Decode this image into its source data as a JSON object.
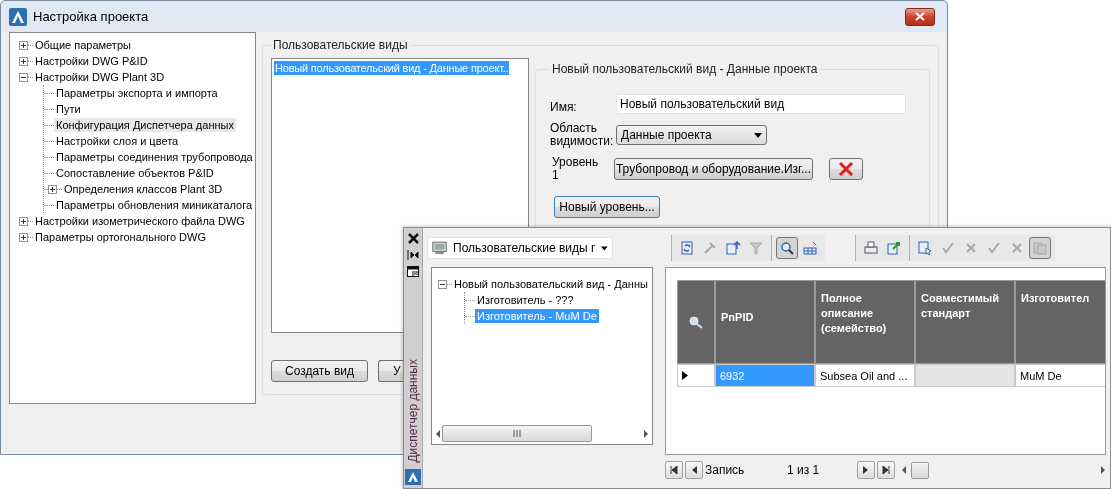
{
  "dialog": {
    "title": "Настройка проекта",
    "tree": [
      {
        "label": "Общие параметры",
        "expanded": false,
        "selected": false
      },
      {
        "label": "Настройки DWG P&ID",
        "expanded": false,
        "selected": false
      },
      {
        "label": "Настройки DWG Plant 3D",
        "expanded": true,
        "selected": false,
        "children": [
          {
            "label": "Параметры экспорта и импорта",
            "selected": false
          },
          {
            "label": "Пути",
            "selected": false
          },
          {
            "label": "Конфигурация Диспетчера данных",
            "selected": true
          },
          {
            "label": "Настройки слоя и цвета",
            "selected": false
          },
          {
            "label": "Параметры соединения трубопровода",
            "selected": false
          },
          {
            "label": "Сопоставление объектов P&ID",
            "selected": false
          },
          {
            "label": "Определения классов Plant 3D",
            "expanded": false,
            "selected": false
          },
          {
            "label": "Параметры обновления миникаталога",
            "selected": false
          }
        ]
      },
      {
        "label": "Настройки изометрического файла DWG",
        "expanded": false,
        "selected": false
      },
      {
        "label": "Параметры ортогонального DWG",
        "expanded": false,
        "selected": false
      }
    ],
    "views_group": {
      "title": "Пользовательские виды",
      "views": [
        {
          "label": "Новый пользовательский вид - Данные проект..",
          "selected": true
        }
      ],
      "buttons": [
        "Создать вид",
        "У"
      ]
    },
    "view_group": {
      "title": "Новый пользовательский вид - Данные проекта",
      "name_label": "Имя:",
      "name_value": "Новый пользовательский вид",
      "scope_label": "Область видимости:",
      "scope_value": "Данные проекта",
      "levels": [
        {
          "label": "Уровень 1",
          "value": "Трубопровод  и оборудование.Изг..."
        }
      ],
      "new_level_button": "Новый уровень..."
    }
  },
  "palette": {
    "side_title": "Диспетчер данных",
    "view_select": "Пользовательские виды г",
    "toolbar": [
      {
        "buttons": [
          {
            "kind": "sync",
            "disabled": false,
            "selected": false
          },
          {
            "kind": "edit",
            "disabled": true,
            "selected": false
          },
          {
            "kind": "upload",
            "disabled": false,
            "selected": false
          },
          {
            "kind": "filter",
            "disabled": true,
            "selected": false
          }
        ]
      },
      {
        "buttons": [
          {
            "kind": "zoom",
            "disabled": false,
            "selected": true
          },
          {
            "kind": "grid",
            "disabled": false,
            "selected": false
          }
        ]
      },
      {
        "buttons": [
          {
            "kind": "print",
            "disabled": false,
            "selected": false
          },
          {
            "kind": "export",
            "disabled": false,
            "selected": false
          }
        ]
      },
      {
        "buttons": [
          {
            "kind": "pick",
            "disabled": false,
            "selected": false
          },
          {
            "kind": "accept",
            "disabled": true,
            "selected": false
          },
          {
            "kind": "reject",
            "disabled": true,
            "selected": false
          },
          {
            "kind": "accept",
            "disabled": true,
            "selected": false
          },
          {
            "kind": "reject",
            "disabled": true,
            "selected": false
          },
          {
            "kind": "compare",
            "disabled": true,
            "selected": true
          }
        ]
      }
    ],
    "tree": [
      {
        "label": "Новый пользовательский вид - Данны",
        "expanded": true,
        "selected": false,
        "children": [
          {
            "label": "Изготовитель - ???",
            "selected": false
          },
          {
            "label": "Изготовитель - MuM De",
            "selected": true
          }
        ]
      }
    ],
    "table": {
      "columns": [
        "PnPID",
        "Полное описание (семейство)",
        "Совместимый стандарт",
        "Изготовител"
      ],
      "rows": [
        {
          "current": true,
          "cells": [
            {
              "text": "6932",
              "selected": true,
              "readonly": false
            },
            {
              "text": "Subsea Oil and ...",
              "selected": false,
              "readonly": false
            },
            {
              "selected": false,
              "readonly": true
            },
            {
              "text": "MuM De",
              "selected": false,
              "readonly": false
            }
          ]
        }
      ]
    },
    "record_label": "Запись",
    "record_position": "1 из 1"
  }
}
